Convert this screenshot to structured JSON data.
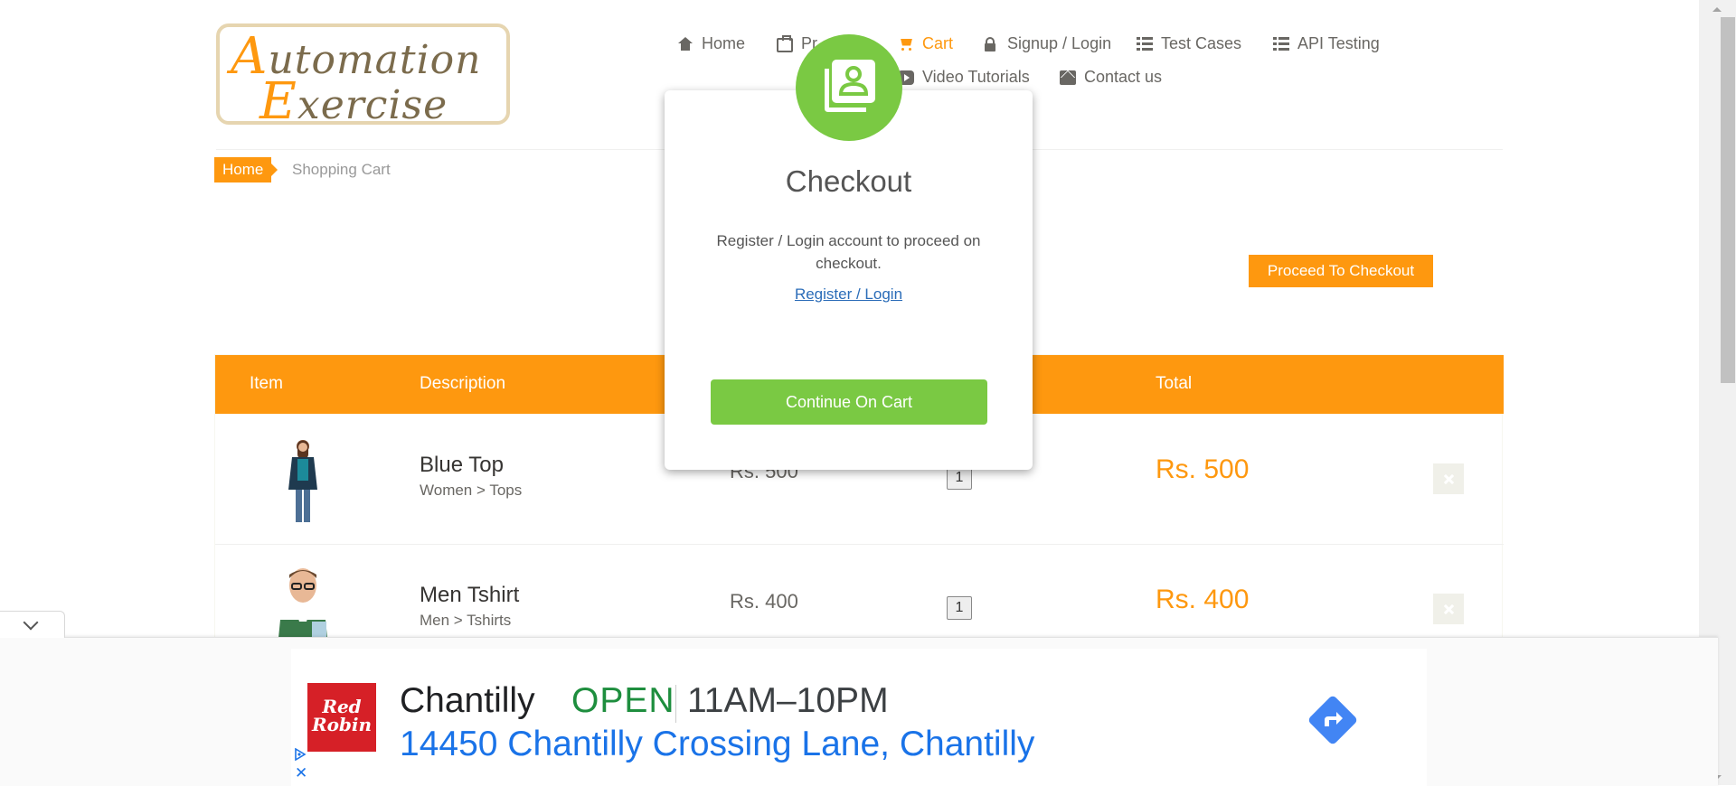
{
  "logo": {
    "line1_cap": "A",
    "line1_rest": "utomation",
    "line2_cap": "E",
    "line2_rest": "xercise"
  },
  "nav": {
    "home": "Home",
    "products": "Pr",
    "cart": "Cart",
    "signup_login": "Signup / Login",
    "test_cases": "Test Cases",
    "api_testing": "API Testing",
    "video_tutorials": "Video Tutorials",
    "contact_us": "Contact us"
  },
  "breadcrumb": {
    "home": "Home",
    "current": "Shopping Cart"
  },
  "proceed_button": "Proceed To Checkout",
  "table": {
    "headers": {
      "item": "Item",
      "description": "Description",
      "total": "Total"
    },
    "rows": [
      {
        "name": "Blue Top",
        "category": "Women > Tops",
        "price": "Rs. 500",
        "quantity": "1",
        "total": "Rs. 500"
      },
      {
        "name": "Men Tshirt",
        "category": "Men > Tshirts",
        "price": "Rs. 400",
        "quantity": "1",
        "total": "Rs. 400"
      }
    ]
  },
  "modal": {
    "title": "Checkout",
    "text": "Register / Login account to proceed on checkout.",
    "link": "Register / Login",
    "button": "Continue On Cart"
  },
  "ad": {
    "logo_line1": "Red",
    "logo_line2": "Robin",
    "name": "Chantilly",
    "status": "OPEN",
    "hours": "11AM–10PM",
    "address": "14450 Chantilly Crossing Lane, Chantilly",
    "close": "✕"
  },
  "colors": {
    "accent": "#fe980f",
    "modal_green": "#7ac943",
    "ad_open_green": "#1e8e3e",
    "ad_link_blue": "#1a73e8",
    "red_robin": "#d62027"
  }
}
